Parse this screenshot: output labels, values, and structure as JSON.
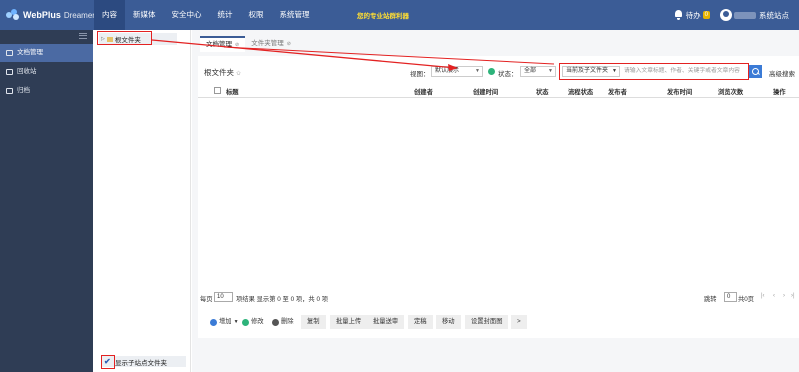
{
  "topbar": {
    "brand": "WebPlus",
    "brand_sub": "Dreamer",
    "nav": [
      "内容",
      "新媒体",
      "安全中心",
      "统计",
      "权限",
      "系统管理"
    ],
    "slogan": "您的专业站群利器",
    "todo_label": "待办",
    "todo_count": "0",
    "site_label": "系统站点"
  },
  "sidebar": {
    "items": [
      {
        "label": "文档管理",
        "icon": "folder-icon"
      },
      {
        "label": "回收站",
        "icon": "trash-icon"
      },
      {
        "label": "归档",
        "icon": "archive-icon"
      }
    ]
  },
  "tree": {
    "root_label": "根文件夹",
    "show_sub_label": "显示子站点文件夹"
  },
  "tabs": [
    {
      "label": "文档管理"
    },
    {
      "label": "文件夹管理"
    }
  ],
  "toolbar_top": {
    "title": "根文件夹",
    "view_label": "视图：",
    "view_value": "默认展示",
    "status_label": "状态：",
    "status_value": "全部",
    "scope_value": "当前及子文件夹",
    "search_placeholder": "请输入文章标题、作者、关键字或者文章内容",
    "advanced_search": "高级搜索"
  },
  "table": {
    "columns": [
      "标题",
      "创建者",
      "创建时间",
      "状态",
      "流程状态",
      "发布者",
      "发布时间",
      "浏览次数",
      "操作"
    ]
  },
  "pagination": {
    "per_page_label": "每页",
    "per_page_value": "10",
    "summary": "项结果 显示第 0 至 0 项，共 0 项",
    "jump_label": "跳转",
    "jump_value": "0",
    "total_pages": "共0页",
    "first": "|‹",
    "prev": "‹",
    "next": "›",
    "last": "›|"
  },
  "actions": {
    "add": "增加",
    "edit": "修改",
    "delete": "删除",
    "copy": "复制",
    "batch_upload": "批量上传",
    "batch_review": "批量送审",
    "finalize": "定稿",
    "move": "移动",
    "set_cover": "设置封面图",
    "more": ">"
  },
  "colors": {
    "topbar": "#3b5c96",
    "sidebar": "#2f3d55",
    "sidebar_active": "#4b6aa3",
    "annotation_red": "#e32222",
    "slogan": "#ffde33",
    "primary_button": "#3b7bd6"
  }
}
